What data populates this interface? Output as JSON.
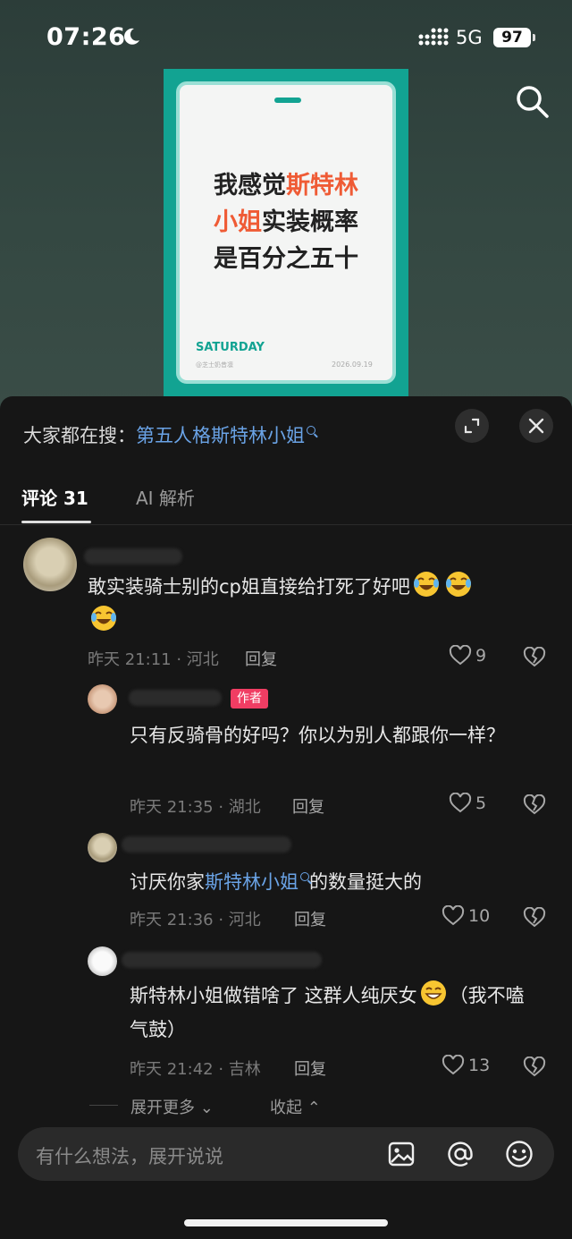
{
  "status_bar": {
    "time": "07:26",
    "network": "5G",
    "battery": "97"
  },
  "poster": {
    "headline": [
      "我感觉",
      "斯特林",
      "小姐",
      "实装概率",
      "是百分之五十"
    ],
    "day": "SATURDAY",
    "handle": "@芝士奶昔凛",
    "date": "2026.09.19"
  },
  "hot_search": {
    "label": "大家都在搜：",
    "keyword": "第五人格斯特林小姐"
  },
  "tabs": [
    {
      "label": "评论 31"
    },
    {
      "label": "AI 解析"
    }
  ],
  "comments": [
    {
      "text": "敢实装骑士别的cp姐直接给打死了好吧",
      "time_location": "昨天 21:11 · 河北",
      "reply_label": "回复",
      "likes": "9"
    },
    {
      "author_tag": "作者",
      "text": "只有反骑骨的好吗？你以为别人都跟你一样？",
      "time_location": "昨天 21:35 · 湖北",
      "reply_label": "回复",
      "likes": "5"
    },
    {
      "text_before": "讨厌你家",
      "keyword": "斯特林小姐",
      "text_after": "的数量挺大的",
      "time_location": "昨天 21:36 · 河北",
      "reply_label": "回复",
      "likes": "10"
    },
    {
      "text_before": "斯特林小姐做错啥了 这群人纯厌女",
      "text_after": "（我不嗑气鼓）",
      "time_location": "昨天 21:42 · 吉林",
      "reply_label": "回复",
      "likes": "13"
    }
  ],
  "thread_controls": {
    "expand_more": "展开更多",
    "collapse": "收起"
  },
  "input": {
    "placeholder": "有什么想法，展开说说"
  },
  "icons": {
    "search": "search-icon",
    "expand": "expand-icon",
    "close": "close-icon",
    "like": "heart-icon",
    "dislike": "broken-heart-icon",
    "image": "image-icon",
    "mention": "at-icon",
    "emoji": "emoji-icon",
    "laugh_emoji": "tears-of-joy-emoji",
    "grin_emoji": "grinning-emoji"
  },
  "colors": {
    "accent_link": "#6aa3e6",
    "author_tag": "#f03d63",
    "poster_bg": "#12a392",
    "poster_highlight": "#ef5b35"
  }
}
